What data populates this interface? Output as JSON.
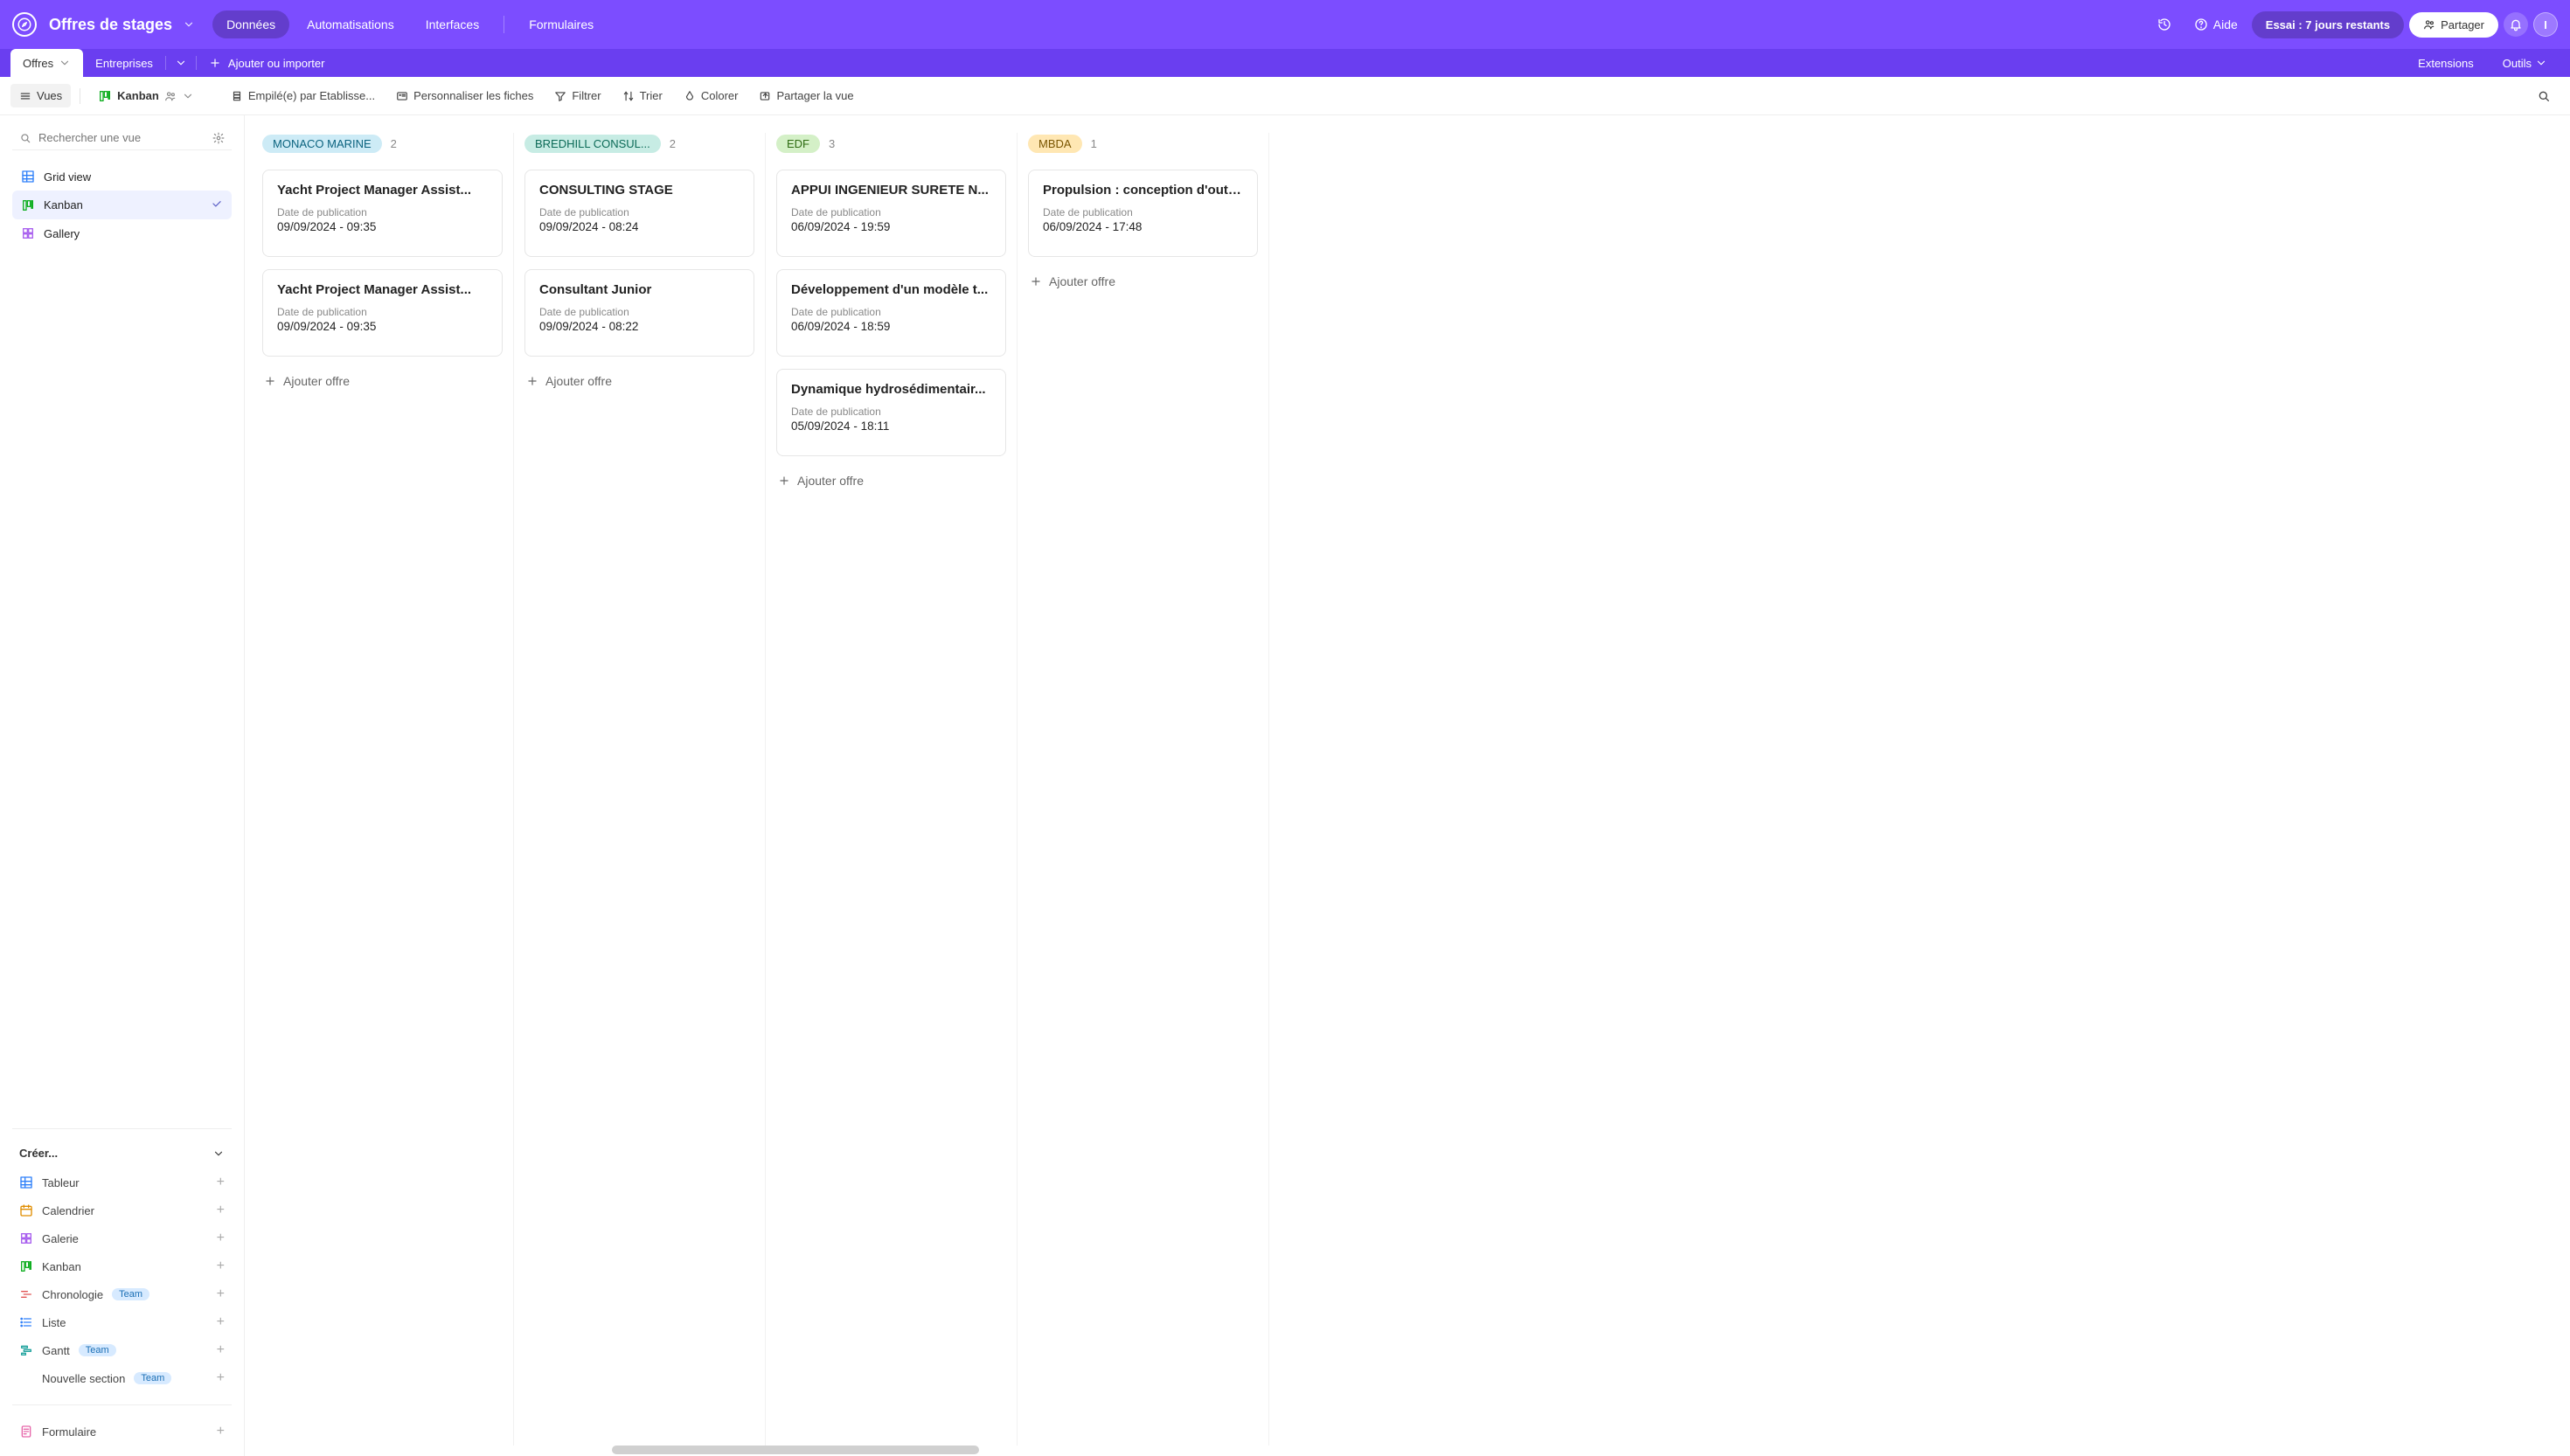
{
  "topbar": {
    "base_title": "Offres de stages",
    "nav": [
      "Données",
      "Automatisations",
      "Interfaces",
      "Formulaires"
    ],
    "help": "Aide",
    "trial": "Essai : 7 jours restants",
    "share": "Partager",
    "avatar_initial": "I"
  },
  "tables": {
    "tabs": [
      "Offres",
      "Entreprises"
    ],
    "add_import": "Ajouter ou importer",
    "extensions": "Extensions",
    "tools": "Outils"
  },
  "viewbar": {
    "views_btn": "Vues",
    "view_name": "Kanban",
    "stacked_by": "Empilé(e) par Etablisse...",
    "customize": "Personnaliser les fiches",
    "filter": "Filtrer",
    "sort": "Trier",
    "color": "Colorer",
    "share_view": "Partager la vue"
  },
  "sidebar": {
    "search_placeholder": "Rechercher une vue",
    "views": [
      {
        "name": "Grid view",
        "icon": "grid",
        "selected": false
      },
      {
        "name": "Kanban",
        "icon": "kanban",
        "selected": true
      },
      {
        "name": "Gallery",
        "icon": "gallery",
        "selected": false
      }
    ],
    "create_header": "Créer...",
    "create_items": [
      {
        "name": "Tableur",
        "icon": "grid",
        "color": "ic-blue"
      },
      {
        "name": "Calendrier",
        "icon": "calendar",
        "color": "ic-orange"
      },
      {
        "name": "Galerie",
        "icon": "gallery",
        "color": "ic-purple"
      },
      {
        "name": "Kanban",
        "icon": "kanban",
        "color": "ic-green"
      },
      {
        "name": "Chronologie",
        "icon": "timeline",
        "color": "ic-red",
        "team": true
      },
      {
        "name": "Liste",
        "icon": "list",
        "color": "ic-blue"
      },
      {
        "name": "Gantt",
        "icon": "gantt",
        "color": "ic-teal",
        "team": true
      },
      {
        "name": "Nouvelle section",
        "icon": "",
        "team": true
      }
    ],
    "form_item": "Formulaire",
    "team_label": "Team"
  },
  "board": {
    "add_card_label": "Ajouter offre",
    "field_label": "Date de publication",
    "columns": [
      {
        "name": "MONACO MARINE",
        "count": 2,
        "tag_bg": "#cdebf6",
        "tag_fg": "#0b637f",
        "cards": [
          {
            "title": "Yacht Project Manager Assist...",
            "date": "09/09/2024 - 09:35"
          },
          {
            "title": "Yacht Project Manager Assist...",
            "date": "09/09/2024 - 09:35"
          }
        ]
      },
      {
        "name": "BREDHILL CONSUL...",
        "count": 2,
        "tag_bg": "#c7ece4",
        "tag_fg": "#0b6a57",
        "cards": [
          {
            "title": "CONSULTING STAGE",
            "date": "09/09/2024 - 08:24"
          },
          {
            "title": "Consultant Junior",
            "date": "09/09/2024 - 08:22"
          }
        ]
      },
      {
        "name": "EDF",
        "count": 3,
        "tag_bg": "#d4f0c7",
        "tag_fg": "#2e6b12",
        "cards": [
          {
            "title": "APPUI INGENIEUR SURETE N...",
            "date": "06/09/2024 - 19:59"
          },
          {
            "title": "Développement d'un modèle t...",
            "date": "06/09/2024 - 18:59"
          },
          {
            "title": "Dynamique hydrosédimentair...",
            "date": "05/09/2024 - 18:11"
          }
        ]
      },
      {
        "name": "MBDA",
        "count": 1,
        "tag_bg": "#ffe7b3",
        "tag_fg": "#7a5500",
        "cards": [
          {
            "title": "Propulsion : conception d'outil...",
            "date": "06/09/2024 - 17:48"
          }
        ]
      }
    ]
  }
}
